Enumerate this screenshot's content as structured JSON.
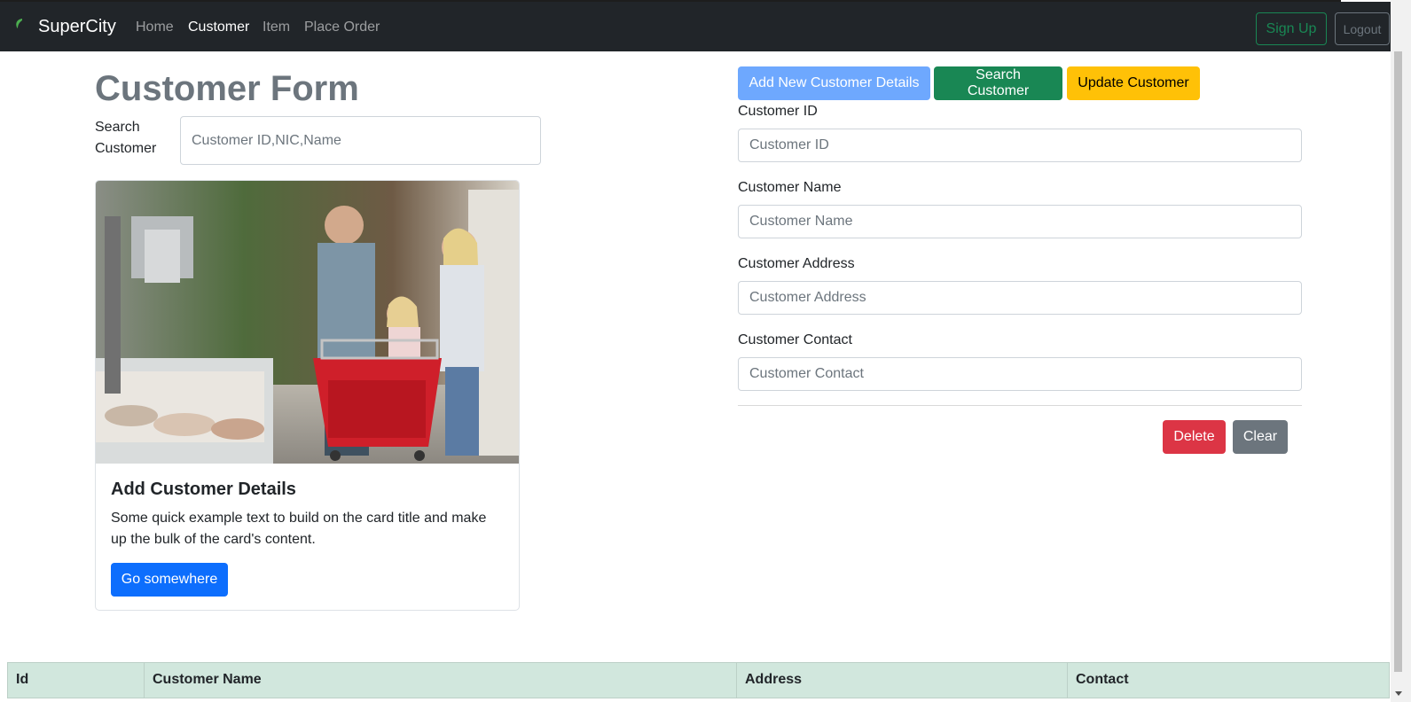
{
  "navbar": {
    "brand": "SuperCity",
    "links": [
      "Home",
      "Customer",
      "Item",
      "Place Order"
    ],
    "active_link": "Customer",
    "signup_label": "Sign Up",
    "logout_label": "Logout"
  },
  "page": {
    "title": "Customer Form",
    "search_label": "Search Customer",
    "search_placeholder": "Customer ID,NIC,Name"
  },
  "card": {
    "image_alt": "Family with shopping cart in supermarket",
    "title": "Add Customer Details",
    "text": "Some quick example text to build on the card title and make up the bulk of the card's content.",
    "button_label": "Go somewhere"
  },
  "actions": {
    "add_label": "Add New Customer Details",
    "search_label": "Search Customer",
    "update_label": "Update Customer"
  },
  "form": {
    "fields": [
      {
        "label": "Customer ID",
        "placeholder": "Customer ID"
      },
      {
        "label": "Customer Name",
        "placeholder": "Customer Name"
      },
      {
        "label": "Customer Address",
        "placeholder": "Customer Address"
      },
      {
        "label": "Customer Contact",
        "placeholder": "Customer Contact"
      }
    ],
    "delete_label": "Delete",
    "clear_label": "Clear"
  },
  "table": {
    "headers": [
      "Id",
      "Customer Name",
      "Address",
      "Contact"
    ]
  },
  "colors": {
    "navbar_bg": "#212529",
    "primary": "#0d6efd",
    "primary_light": "#6ea8fe",
    "success": "#198754",
    "warning": "#ffc107",
    "danger": "#dc3545",
    "secondary": "#6c757d",
    "table_head_bg": "#d1e7dd"
  }
}
